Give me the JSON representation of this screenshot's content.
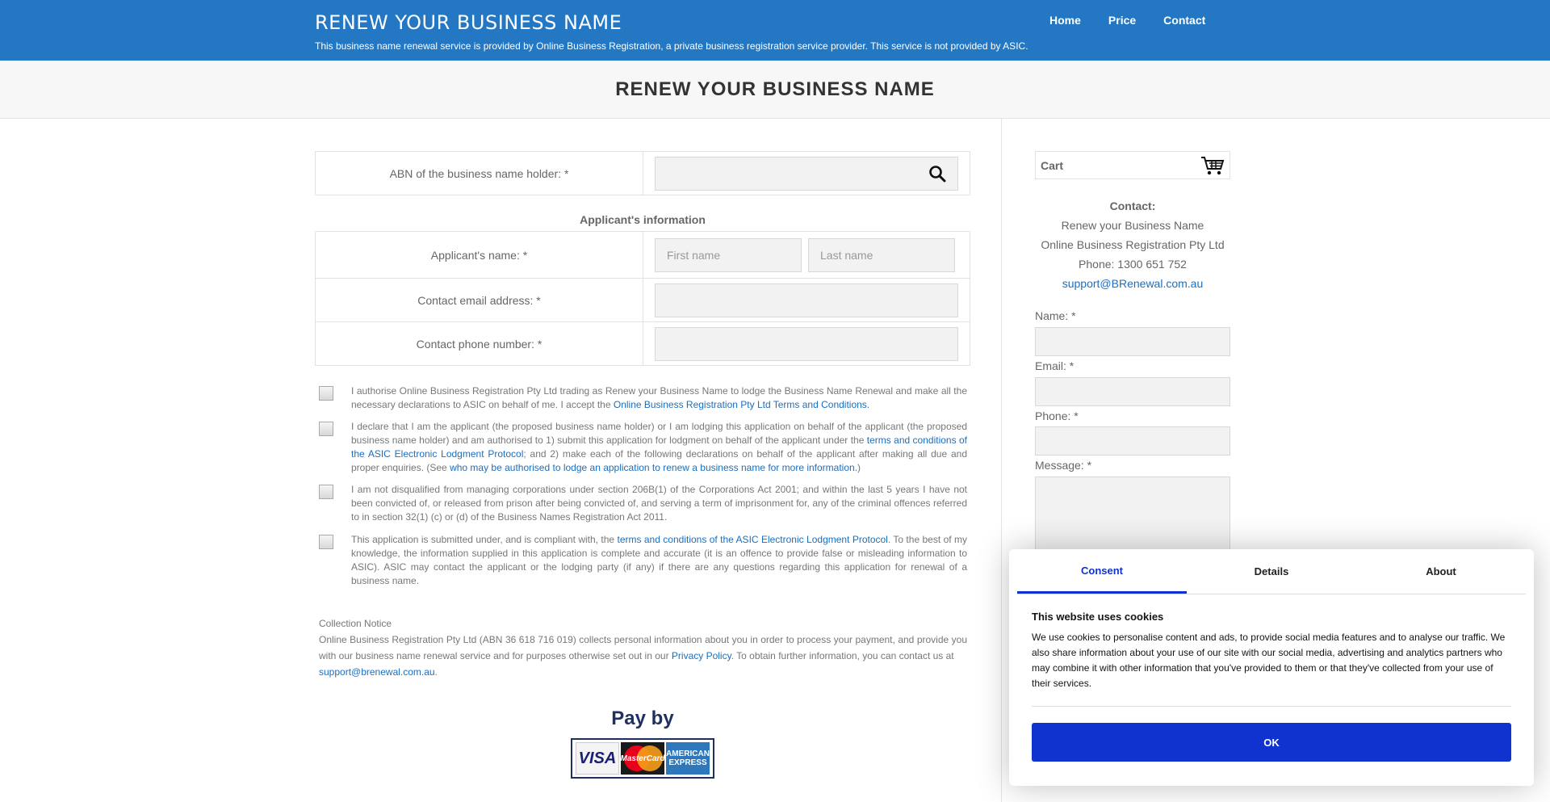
{
  "header": {
    "brand": "RENEW YOUR BUSINESS NAME",
    "tagline": "This business name renewal service is provided by Online Business Registration, a private business registration service provider. This service is not provided by ASIC.",
    "nav": [
      "Home",
      "Price",
      "Contact"
    ]
  },
  "page_title": "RENEW YOUR BUSINESS NAME",
  "form": {
    "abn_label": "ABN of the business name holder: *",
    "applicant_section": "Applicant's information",
    "name_label": "Applicant's name: *",
    "first_name_placeholder": "First name",
    "last_name_placeholder": "Last name",
    "email_label": "Contact email address: *",
    "phone_label": "Contact phone number: *"
  },
  "declarations": [
    {
      "pre": "I authorise Online Business Registration Pty Ltd trading as Renew your Business Name to lodge the Business Name Renewal and make all the necessary declarations to ASIC on behalf of me. I accept the ",
      "link": "Online Business Registration Pty Ltd Terms and Conditions.",
      "post": ""
    },
    {
      "pre": "I declare that I am the applicant (the proposed business name holder) or I am lodging this application on behalf of the applicant (the proposed business name holder) and am authorised to 1) submit this application for lodgment on behalf of the applicant under the ",
      "link": "terms and conditions of the ASIC Electronic Lodgment Protocol",
      "mid": "; and 2) make each of the following declarations on behalf of the applicant after making all due and proper enquiries. (See ",
      "link2": "who may be authorised to lodge an application to renew a business name for more information.",
      "post": ")"
    },
    {
      "pre": "I am not disqualified from managing corporations under section 206B(1) of the Corporations Act 2001; and within the last 5 years I have not been convicted of, or released from prison after being convicted of, and serving a term of imprisonment for, any of the criminal offences referred to in section 32(1) (c) or (d) of the Business Names Registration Act 2011.",
      "link": "",
      "post": ""
    },
    {
      "pre": "This application is submitted under, and is compliant with, the ",
      "link": "terms and conditions of the ASIC Electronic Lodgment Protocol",
      "post": ". To the best of my knowledge, the information supplied in this application is complete and accurate (it is an offence to provide false or misleading information to ASIC). ASIC may contact the applicant or the lodging party (if any) if there are any questions regarding this application for renewal of a business name."
    }
  ],
  "notice": {
    "title": "Collection Notice",
    "pre": "Online Business Registration Pty Ltd (ABN 36 618 716 019) collects personal information about you in order to process your payment, and provide you with our business name renewal service and for purposes otherwise set out in our ",
    "privacy_link": "Privacy Policy",
    "mid": ". To obtain further information, you can contact us at ",
    "email_link": "support@brenewal.com.au",
    "post": "."
  },
  "payment": {
    "title": "Pay by",
    "cards": [
      "VISA",
      "MasterCard",
      "AMERICAN EXPRESS"
    ]
  },
  "sidebar": {
    "cart_label": "Cart",
    "contact_heading": "Contact:",
    "contact_lines": [
      "Renew your Business Name",
      "Online Business Registration Pty Ltd",
      "Phone: 1300 651 752"
    ],
    "contact_email": "support@BRenewal.com.au",
    "name_label": "Name: *",
    "email_label": "Email: *",
    "phone_label": "Phone: *",
    "message_label": "Message: *"
  },
  "cookie": {
    "tabs": [
      "Consent",
      "Details",
      "About"
    ],
    "title": "This website uses cookies",
    "body": "We use cookies to personalise content and ads, to provide social media features and to analyse our traffic. We also share information about your use of our site with our social media, advertising and analytics partners who may combine it with other information that you've provided to them or that they've collected from your use of their services.",
    "ok_label": "OK"
  },
  "colors": {
    "header_bg": "#2377c3",
    "link": "#1a6fc0",
    "cookie_accent": "#1032cf"
  }
}
